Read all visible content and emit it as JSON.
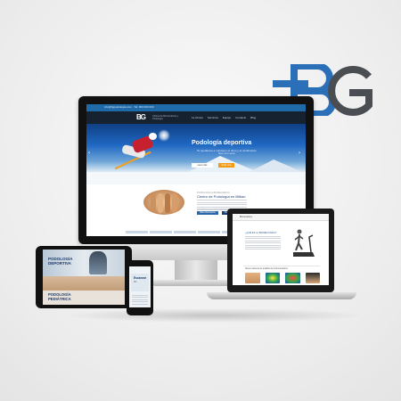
{
  "brand": {
    "logo_text": "BG"
  },
  "desktop_site": {
    "topbar_text": "info@bgpodologia.com  ·  Tel: 000 000 000",
    "logo": "BG",
    "tagline": "Clínica de Biomecánica y Podología",
    "menu": [
      "La clínica",
      "Servicios",
      "Equipo",
      "Contacto",
      "Blog"
    ],
    "hero": {
      "title": "Podología deportiva",
      "subtitle": "Te ayudamos a mantener el ritmo y el rendimiento",
      "note": "Más información",
      "button_primary": "Leer más",
      "button_secondary": "Pedir cita"
    },
    "section": {
      "label": "PODOLOGÍA & BIOMECÁNICA",
      "title": "Centro de Podología en Bilbao",
      "button_primary": "Más información",
      "button_secondary": "Pedir cita"
    }
  },
  "laptop_site": {
    "nav_label": "Biomecánica",
    "section_title": "¿QUÉ ES LA BIOMECÁNICA?",
    "lower_section": "Nuevo sistema de análisis de la biomecánica"
  },
  "tablet_site": {
    "hero_title": "PODOLOGÍA DEPORTIVA",
    "second_title": "PODOLOGÍA PEDIÁTRICA"
  },
  "phone_site": {
    "card_title": "Escanear",
    "card_sub": "3D"
  },
  "colors": {
    "brand_blue": "#2a6fb8",
    "brand_gray": "#4a4d52",
    "accent_orange": "#f29a12"
  }
}
